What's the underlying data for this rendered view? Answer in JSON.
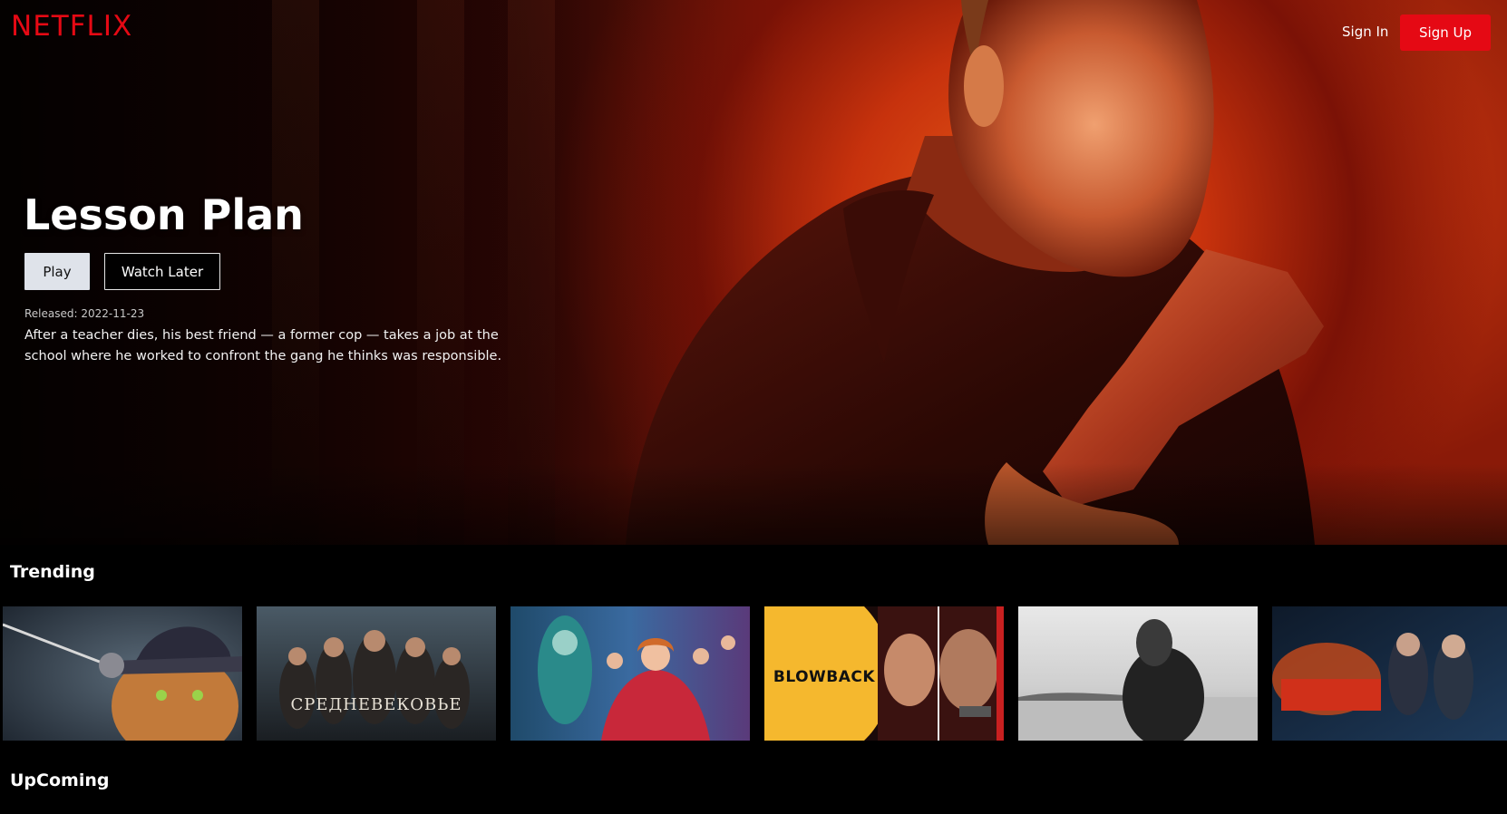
{
  "nav": {
    "logo": "NETFLIX",
    "sign_in": "Sign In",
    "sign_up": "Sign Up"
  },
  "hero": {
    "title": "Lesson Plan",
    "play_label": "Play",
    "watch_later_label": "Watch Later",
    "released": "Released: 2022-11-23",
    "description": "After a teacher dies, his best friend — a former cop — takes a job at the school where he worked to confront the gang he thinks was responsible."
  },
  "rows": {
    "trending": {
      "title": "Trending",
      "tiles": [
        {
          "poster_text": ""
        },
        {
          "poster_text": "СРЕДНЕВЕКОВЬЕ"
        },
        {
          "poster_text": ""
        },
        {
          "poster_text": "BLOWBACK"
        },
        {
          "poster_text": ""
        },
        {
          "poster_text": ""
        }
      ]
    },
    "upcoming": {
      "title": "UpComing"
    }
  },
  "colors": {
    "brand": "#e50914",
    "background": "#000000",
    "play_button": "#dfe3ea"
  }
}
